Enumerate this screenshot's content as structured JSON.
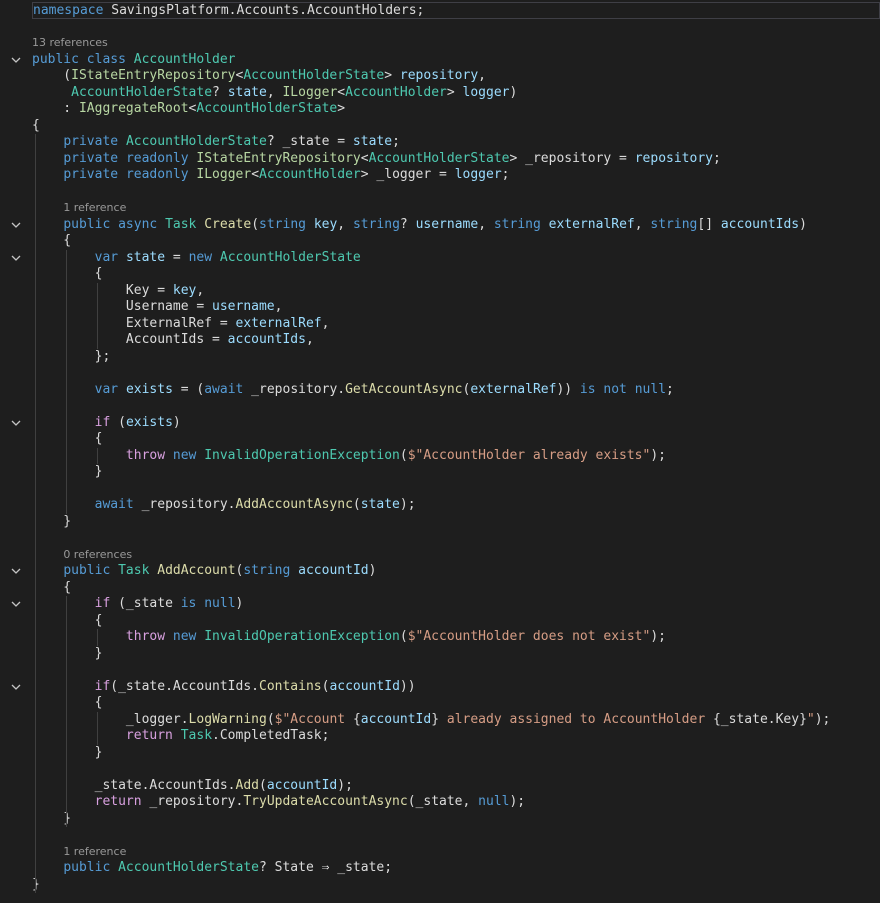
{
  "editor": {
    "lines": [
      {
        "type": "code",
        "tokens": [
          [
            "k",
            "namespace"
          ],
          [
            "d",
            " SavingsPlatform.Accounts.AccountHolders;"
          ]
        ]
      },
      {
        "type": "blank"
      },
      {
        "type": "lens",
        "text": "13 references"
      },
      {
        "type": "code",
        "fold": true,
        "tokens": [
          [
            "k",
            "public"
          ],
          [
            "d",
            " "
          ],
          [
            "k",
            "class"
          ],
          [
            "d",
            " "
          ],
          [
            "t",
            "AccountHolder"
          ]
        ]
      },
      {
        "type": "code",
        "tokens": [
          [
            "d",
            "    ("
          ],
          [
            "i",
            "IStateEntryRepository"
          ],
          [
            "d",
            "<"
          ],
          [
            "t",
            "AccountHolderState"
          ],
          [
            "d",
            "> "
          ],
          [
            "p",
            "repository"
          ],
          [
            "d",
            ","
          ]
        ]
      },
      {
        "type": "code",
        "tokens": [
          [
            "d",
            "     "
          ],
          [
            "t",
            "AccountHolderState"
          ],
          [
            "d",
            "? "
          ],
          [
            "p",
            "state"
          ],
          [
            "d",
            ", "
          ],
          [
            "i",
            "ILogger"
          ],
          [
            "d",
            "<"
          ],
          [
            "t",
            "AccountHolder"
          ],
          [
            "d",
            "> "
          ],
          [
            "p",
            "logger"
          ],
          [
            "d",
            ")"
          ]
        ]
      },
      {
        "type": "code",
        "tokens": [
          [
            "d",
            "    : "
          ],
          [
            "i",
            "IAggregateRoot"
          ],
          [
            "d",
            "<"
          ],
          [
            "t",
            "AccountHolderState"
          ],
          [
            "d",
            ">"
          ]
        ]
      },
      {
        "type": "code",
        "tokens": [
          [
            "d",
            "{"
          ]
        ]
      },
      {
        "type": "code",
        "tokens": [
          [
            "d",
            "    "
          ],
          [
            "k",
            "private"
          ],
          [
            "d",
            " "
          ],
          [
            "t",
            "AccountHolderState"
          ],
          [
            "d",
            "? _state = "
          ],
          [
            "p",
            "state"
          ],
          [
            "d",
            ";"
          ]
        ]
      },
      {
        "type": "code",
        "tokens": [
          [
            "d",
            "    "
          ],
          [
            "k",
            "private"
          ],
          [
            "d",
            " "
          ],
          [
            "k",
            "readonly"
          ],
          [
            "d",
            " "
          ],
          [
            "i",
            "IStateEntryRepository"
          ],
          [
            "d",
            "<"
          ],
          [
            "t",
            "AccountHolderState"
          ],
          [
            "d",
            "> _repository = "
          ],
          [
            "p",
            "repository"
          ],
          [
            "d",
            ";"
          ]
        ]
      },
      {
        "type": "code",
        "tokens": [
          [
            "d",
            "    "
          ],
          [
            "k",
            "private"
          ],
          [
            "d",
            " "
          ],
          [
            "k",
            "readonly"
          ],
          [
            "d",
            " "
          ],
          [
            "i",
            "ILogger"
          ],
          [
            "d",
            "<"
          ],
          [
            "t",
            "AccountHolder"
          ],
          [
            "d",
            "> _logger = "
          ],
          [
            "p",
            "logger"
          ],
          [
            "d",
            ";"
          ]
        ]
      },
      {
        "type": "blank"
      },
      {
        "type": "lens",
        "indent": "    ",
        "text": "1 reference"
      },
      {
        "type": "code",
        "fold": true,
        "tokens": [
          [
            "d",
            "    "
          ],
          [
            "k",
            "public"
          ],
          [
            "d",
            " "
          ],
          [
            "k",
            "async"
          ],
          [
            "d",
            " "
          ],
          [
            "t",
            "Task"
          ],
          [
            "d",
            " "
          ],
          [
            "m",
            "Create"
          ],
          [
            "d",
            "("
          ],
          [
            "k",
            "string"
          ],
          [
            "d",
            " "
          ],
          [
            "p",
            "key"
          ],
          [
            "d",
            ", "
          ],
          [
            "k",
            "string"
          ],
          [
            "d",
            "? "
          ],
          [
            "p",
            "username"
          ],
          [
            "d",
            ", "
          ],
          [
            "k",
            "string"
          ],
          [
            "d",
            " "
          ],
          [
            "p",
            "externalRef"
          ],
          [
            "d",
            ", "
          ],
          [
            "k",
            "string"
          ],
          [
            "d",
            "[] "
          ],
          [
            "p",
            "accountIds"
          ],
          [
            "d",
            ")"
          ]
        ]
      },
      {
        "type": "code",
        "tokens": [
          [
            "d",
            "    {"
          ]
        ]
      },
      {
        "type": "code",
        "fold": true,
        "tokens": [
          [
            "d",
            "        "
          ],
          [
            "k",
            "var"
          ],
          [
            "d",
            " "
          ],
          [
            "p",
            "state"
          ],
          [
            "d",
            " = "
          ],
          [
            "k",
            "new"
          ],
          [
            "d",
            " "
          ],
          [
            "t",
            "AccountHolderState"
          ]
        ]
      },
      {
        "type": "code",
        "tokens": [
          [
            "d",
            "        {"
          ]
        ]
      },
      {
        "type": "code",
        "tokens": [
          [
            "d",
            "            Key = "
          ],
          [
            "p",
            "key"
          ],
          [
            "d",
            ","
          ]
        ]
      },
      {
        "type": "code",
        "tokens": [
          [
            "d",
            "            Username = "
          ],
          [
            "p",
            "username"
          ],
          [
            "d",
            ","
          ]
        ]
      },
      {
        "type": "code",
        "tokens": [
          [
            "d",
            "            ExternalRef = "
          ],
          [
            "p",
            "externalRef"
          ],
          [
            "d",
            ","
          ]
        ]
      },
      {
        "type": "code",
        "tokens": [
          [
            "d",
            "            AccountIds = "
          ],
          [
            "p",
            "accountIds"
          ],
          [
            "d",
            ","
          ]
        ]
      },
      {
        "type": "code",
        "tokens": [
          [
            "d",
            "        };"
          ]
        ]
      },
      {
        "type": "blank"
      },
      {
        "type": "code",
        "tokens": [
          [
            "d",
            "        "
          ],
          [
            "k",
            "var"
          ],
          [
            "d",
            " "
          ],
          [
            "p",
            "exists"
          ],
          [
            "d",
            " = ("
          ],
          [
            "k",
            "await"
          ],
          [
            "d",
            " _repository."
          ],
          [
            "m",
            "GetAccountAsync"
          ],
          [
            "d",
            "("
          ],
          [
            "p",
            "externalRef"
          ],
          [
            "d",
            ")) "
          ],
          [
            "k",
            "is"
          ],
          [
            "d",
            " "
          ],
          [
            "k",
            "not"
          ],
          [
            "d",
            " "
          ],
          [
            "k",
            "null"
          ],
          [
            "d",
            ";"
          ]
        ]
      },
      {
        "type": "blank"
      },
      {
        "type": "code",
        "fold": true,
        "tokens": [
          [
            "d",
            "        "
          ],
          [
            "kc",
            "if"
          ],
          [
            "d",
            " ("
          ],
          [
            "p",
            "exists"
          ],
          [
            "d",
            ")"
          ]
        ]
      },
      {
        "type": "code",
        "tokens": [
          [
            "d",
            "        {"
          ]
        ]
      },
      {
        "type": "code",
        "tokens": [
          [
            "d",
            "            "
          ],
          [
            "kc",
            "throw"
          ],
          [
            "d",
            " "
          ],
          [
            "k",
            "new"
          ],
          [
            "d",
            " "
          ],
          [
            "t",
            "InvalidOperationException"
          ],
          [
            "d",
            "("
          ],
          [
            "s",
            "$\"AccountHolder already exists\""
          ],
          [
            "d",
            ");"
          ]
        ]
      },
      {
        "type": "code",
        "tokens": [
          [
            "d",
            "        }"
          ]
        ]
      },
      {
        "type": "blank"
      },
      {
        "type": "code",
        "tokens": [
          [
            "d",
            "        "
          ],
          [
            "k",
            "await"
          ],
          [
            "d",
            " _repository."
          ],
          [
            "m",
            "AddAccountAsync"
          ],
          [
            "d",
            "("
          ],
          [
            "p",
            "state"
          ],
          [
            "d",
            ");"
          ]
        ]
      },
      {
        "type": "code",
        "tokens": [
          [
            "d",
            "    }"
          ]
        ]
      },
      {
        "type": "blank"
      },
      {
        "type": "lens",
        "indent": "    ",
        "text": "0 references"
      },
      {
        "type": "code",
        "fold": true,
        "tokens": [
          [
            "d",
            "    "
          ],
          [
            "k",
            "public"
          ],
          [
            "d",
            " "
          ],
          [
            "t",
            "Task"
          ],
          [
            "d",
            " "
          ],
          [
            "m",
            "AddAccount"
          ],
          [
            "d",
            "("
          ],
          [
            "k",
            "string"
          ],
          [
            "d",
            " "
          ],
          [
            "p",
            "accountId"
          ],
          [
            "d",
            ")"
          ]
        ]
      },
      {
        "type": "code",
        "tokens": [
          [
            "d",
            "    {"
          ]
        ]
      },
      {
        "type": "code",
        "fold": true,
        "tokens": [
          [
            "d",
            "        "
          ],
          [
            "kc",
            "if"
          ],
          [
            "d",
            " (_state "
          ],
          [
            "k",
            "is"
          ],
          [
            "d",
            " "
          ],
          [
            "k",
            "null"
          ],
          [
            "d",
            ")"
          ]
        ]
      },
      {
        "type": "code",
        "tokens": [
          [
            "d",
            "        {"
          ]
        ]
      },
      {
        "type": "code",
        "tokens": [
          [
            "d",
            "            "
          ],
          [
            "kc",
            "throw"
          ],
          [
            "d",
            " "
          ],
          [
            "k",
            "new"
          ],
          [
            "d",
            " "
          ],
          [
            "t",
            "InvalidOperationException"
          ],
          [
            "d",
            "("
          ],
          [
            "s",
            "$\"AccountHolder does not exist\""
          ],
          [
            "d",
            ");"
          ]
        ]
      },
      {
        "type": "code",
        "tokens": [
          [
            "d",
            "        }"
          ]
        ]
      },
      {
        "type": "blank"
      },
      {
        "type": "code",
        "fold": true,
        "tokens": [
          [
            "d",
            "        "
          ],
          [
            "kc",
            "if"
          ],
          [
            "d",
            "(_state.AccountIds."
          ],
          [
            "m",
            "Contains"
          ],
          [
            "d",
            "("
          ],
          [
            "p",
            "accountId"
          ],
          [
            "d",
            "))"
          ]
        ]
      },
      {
        "type": "code",
        "tokens": [
          [
            "d",
            "        {"
          ]
        ]
      },
      {
        "type": "code",
        "tokens": [
          [
            "d",
            "            _logger."
          ],
          [
            "m",
            "LogWarning"
          ],
          [
            "d",
            "("
          ],
          [
            "s",
            "$\"Account "
          ],
          [
            "d",
            "{"
          ],
          [
            "p",
            "accountId"
          ],
          [
            "d",
            "}"
          ],
          [
            "s",
            " already assigned to AccountHolder "
          ],
          [
            "d",
            "{_state.Key}"
          ],
          [
            "s",
            "\""
          ],
          [
            "d",
            ");"
          ]
        ]
      },
      {
        "type": "code",
        "tokens": [
          [
            "d",
            "            "
          ],
          [
            "kc",
            "return"
          ],
          [
            "d",
            " "
          ],
          [
            "t",
            "Task"
          ],
          [
            "d",
            ".CompletedTask;"
          ]
        ]
      },
      {
        "type": "code",
        "tokens": [
          [
            "d",
            "        }"
          ]
        ]
      },
      {
        "type": "blank"
      },
      {
        "type": "code",
        "tokens": [
          [
            "d",
            "        _state.AccountIds."
          ],
          [
            "m",
            "Add"
          ],
          [
            "d",
            "("
          ],
          [
            "p",
            "accountId"
          ],
          [
            "d",
            ");"
          ]
        ]
      },
      {
        "type": "code",
        "tokens": [
          [
            "d",
            "        "
          ],
          [
            "kc",
            "return"
          ],
          [
            "d",
            " _repository."
          ],
          [
            "m",
            "TryUpdateAccountAsync"
          ],
          [
            "d",
            "(_state, "
          ],
          [
            "k",
            "null"
          ],
          [
            "d",
            ");"
          ]
        ]
      },
      {
        "type": "code",
        "tokens": [
          [
            "d",
            "    }"
          ]
        ]
      },
      {
        "type": "blank"
      },
      {
        "type": "lens",
        "indent": "    ",
        "text": "1 reference"
      },
      {
        "type": "code",
        "tokens": [
          [
            "d",
            "    "
          ],
          [
            "k",
            "public"
          ],
          [
            "d",
            " "
          ],
          [
            "t",
            "AccountHolderState"
          ],
          [
            "d",
            "? State ⇒ _state;"
          ]
        ]
      },
      {
        "type": "code",
        "tokens": [
          [
            "d",
            "}"
          ]
        ]
      }
    ]
  }
}
